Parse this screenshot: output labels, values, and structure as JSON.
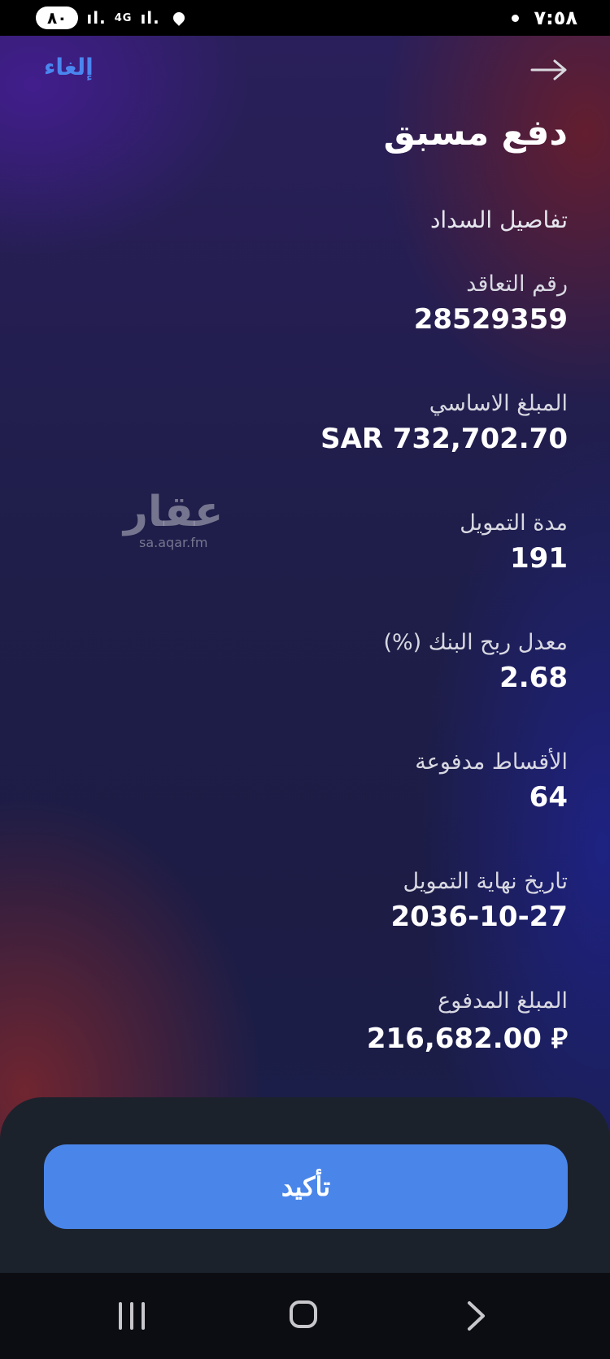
{
  "status_bar": {
    "battery": "٨٠",
    "network": "4G",
    "time": "٧:٥٨"
  },
  "header": {
    "cancel_label": "إلغاء",
    "back_icon": "arrow-right-icon",
    "title": "دفع مسبق"
  },
  "section_title": "تفاصيل السداد",
  "fields": [
    {
      "label": "رقم التعاقد",
      "value": "28529359"
    },
    {
      "label": "المبلغ الاساسي",
      "value": "SAR 732,702.70"
    },
    {
      "label": "مدة التمويل",
      "value": "191"
    },
    {
      "label": "معدل ربح البنك (%)",
      "value": "2.68"
    },
    {
      "label": "الأقساط مدفوعة",
      "value": "64"
    },
    {
      "label": "تاريخ نهاية التمويل",
      "value": "2036-10-27"
    },
    {
      "label": "المبلغ المدفوع",
      "value": "216,682.00 ⃁"
    }
  ],
  "watermark": {
    "text": "عقار",
    "url": "sa.aqar.fm"
  },
  "confirm_label": "تأكيد",
  "colors": {
    "accent": "#4a86ea",
    "sheet": "#1c222c"
  }
}
